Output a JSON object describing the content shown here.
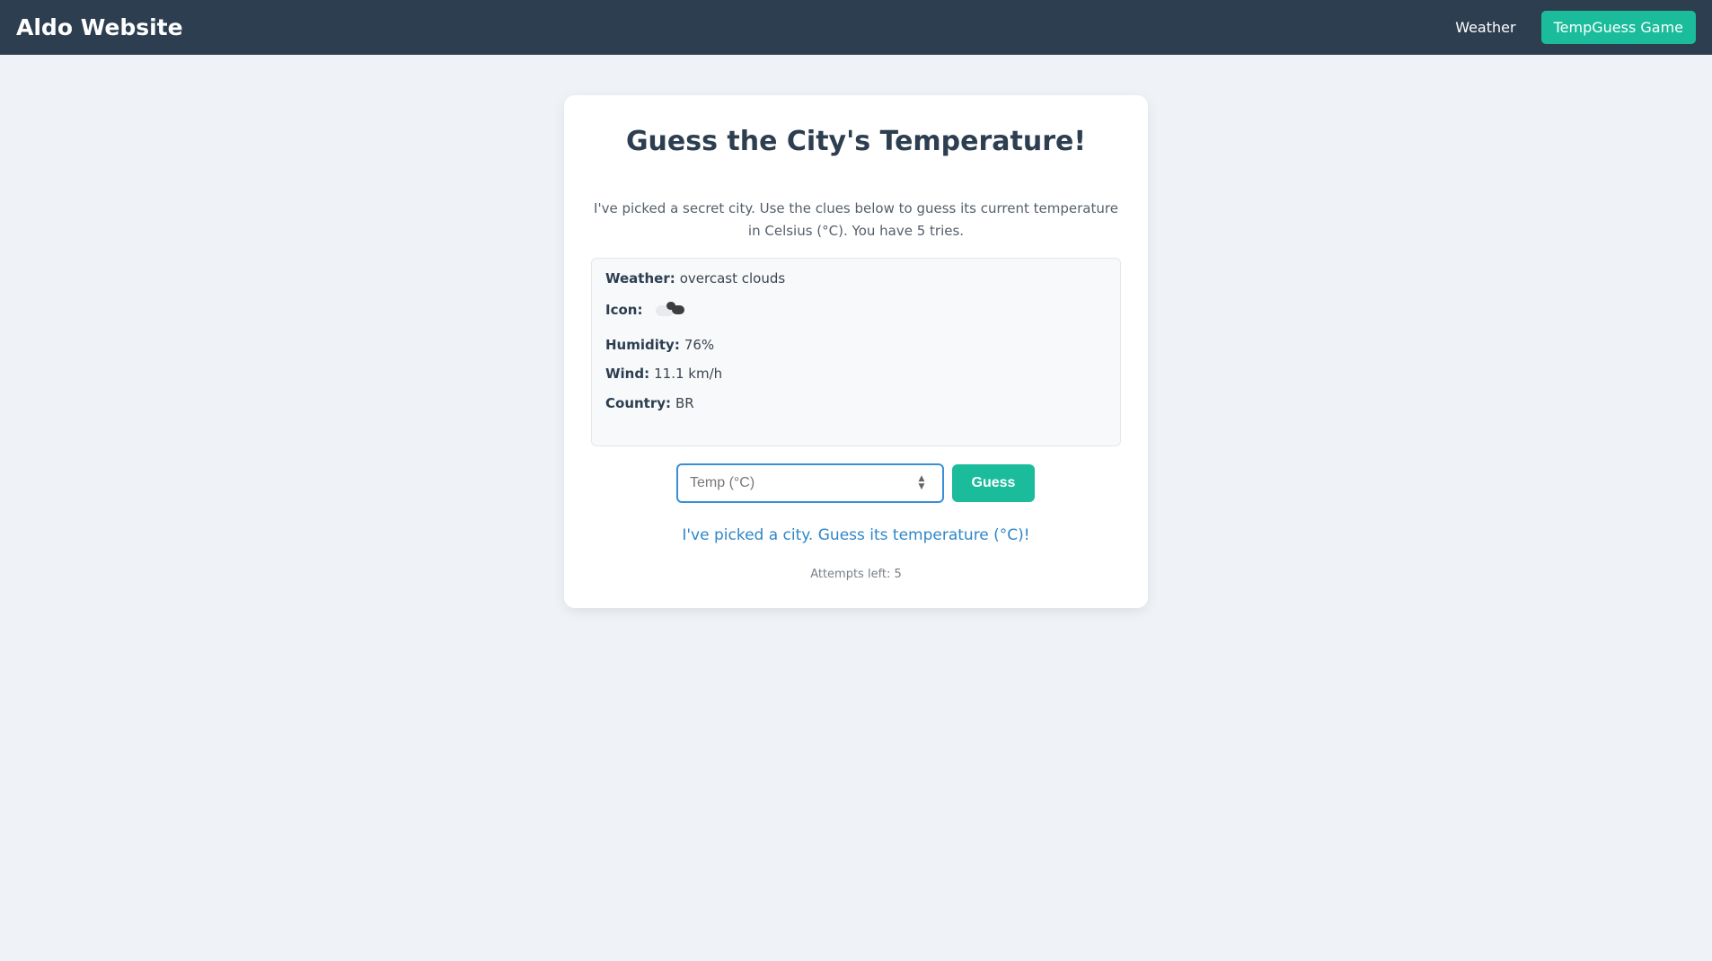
{
  "navbar": {
    "brand": "Aldo Website",
    "links": [
      {
        "label": "Weather",
        "active": false
      },
      {
        "label": "TempGuess Game",
        "active": true
      }
    ],
    "accent_color": "#1abc9c",
    "background_color": "#2c3e50"
  },
  "game": {
    "title": "Guess the City's Temperature!",
    "intro": "I've picked a secret city. Use the clues below to guess its current temperature in Celsius (°C). You have 5 tries.",
    "clues": {
      "weather_label": "Weather:",
      "weather_value": "overcast clouds",
      "icon_label": "Icon:",
      "icon_name": "overcast-clouds-icon",
      "humidity_label": "Humidity:",
      "humidity_value": "76%",
      "wind_label": "Wind:",
      "wind_value": "11.1 km/h",
      "country_label": "Country:",
      "country_value": "BR"
    },
    "input": {
      "placeholder": "Temp (°C)",
      "value": ""
    },
    "guess_button": "Guess",
    "message": "I've picked a city. Guess its temperature (°C)!",
    "attempts": "Attempts left: 5"
  }
}
